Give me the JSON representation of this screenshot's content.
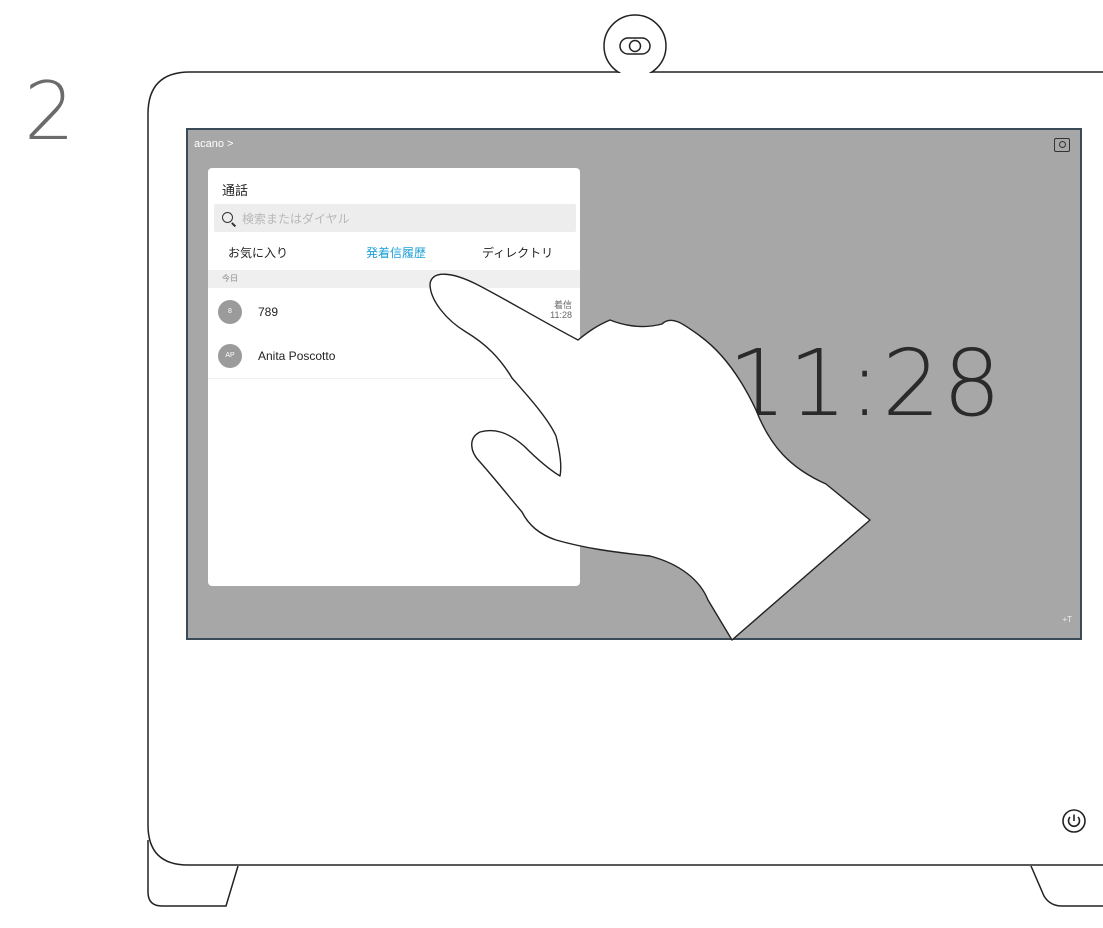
{
  "step": {
    "number": "2"
  },
  "screen": {
    "breadcrumb": "acano >",
    "clock": "11:28",
    "corner_text": "+T"
  },
  "call_panel": {
    "title": "通話",
    "search": {
      "placeholder": "検索またはダイヤル",
      "value": ""
    },
    "tabs": [
      {
        "label": "お気に入り",
        "active": false
      },
      {
        "label": "発着信履歴",
        "active": true
      },
      {
        "label": "ディレクトリ",
        "active": false
      }
    ],
    "section_header": "今日",
    "entries": [
      {
        "avatar": "8",
        "name": "789",
        "status": "着信",
        "time": "11:28"
      },
      {
        "avatar": "AP",
        "name": "Anita Poscotto",
        "status": "",
        "time": ""
      }
    ]
  },
  "colors": {
    "accent": "#1fa0d8",
    "screen_bg": "#a7a7a7",
    "screen_border": "#3a4b57",
    "avatar_bg": "#9b9b9b"
  },
  "icons": [
    "camera-icon",
    "self-view-icon",
    "search-icon",
    "power-icon",
    "hand-pointer-icon"
  ]
}
